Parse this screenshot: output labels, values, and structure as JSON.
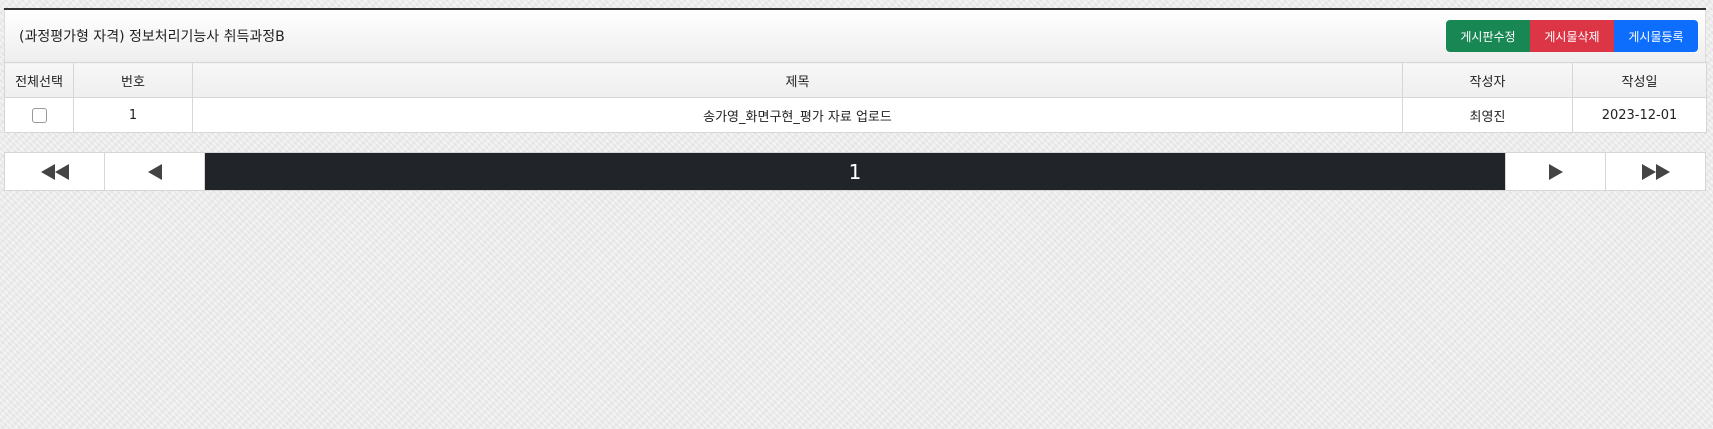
{
  "board": {
    "title": "(과정평가형 자격) 정보처리기능사 취득과정B",
    "buttons": {
      "edit_board": "게시판수정",
      "delete_post": "게시물삭제",
      "add_post": "게시물등록"
    }
  },
  "table": {
    "headers": {
      "select_all": "전체선택",
      "number": "번호",
      "title": "제목",
      "author": "작성자",
      "date": "작성일"
    },
    "rows": [
      {
        "checked": false,
        "number": "1",
        "title": "송가영_화면구현_평가 자료 업로드",
        "author": "최영진",
        "date": "2023-12-01"
      }
    ]
  },
  "pagination": {
    "current_page": "1",
    "icons": [
      "first-page-icon",
      "prev-page-icon",
      "next-page-icon",
      "last-page-icon"
    ]
  },
  "colors": {
    "edit": "#198754",
    "delete": "#dc3545",
    "add": "#0d6efd",
    "current_page_bg": "#212529"
  }
}
